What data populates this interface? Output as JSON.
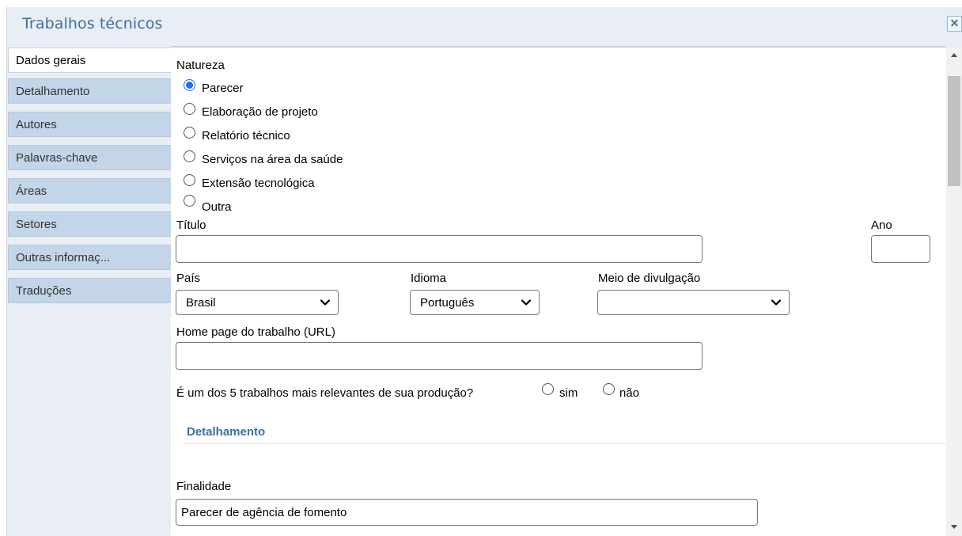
{
  "window": {
    "title": "Trabalhos técnicos",
    "close_icon": "close-icon"
  },
  "sidebar": {
    "items": [
      {
        "label": "Dados gerais",
        "active": true
      },
      {
        "label": "Detalhamento",
        "active": false
      },
      {
        "label": "Autores",
        "active": false
      },
      {
        "label": "Palavras-chave",
        "active": false
      },
      {
        "label": "Áreas",
        "active": false
      },
      {
        "label": "Setores",
        "active": false
      },
      {
        "label": "Outras informaç...",
        "active": false
      },
      {
        "label": "Traduções",
        "active": false
      }
    ]
  },
  "form": {
    "natureza": {
      "label": "Natureza",
      "options": [
        {
          "label": "Parecer",
          "checked": true
        },
        {
          "label": "Elaboração de projeto",
          "checked": false
        },
        {
          "label": "Relatório técnico",
          "checked": false
        },
        {
          "label": "Serviços na área da saúde",
          "checked": false
        },
        {
          "label": "Extensão tecnológica",
          "checked": false
        },
        {
          "label": "Outra",
          "checked": false
        }
      ]
    },
    "titulo": {
      "label": "Título",
      "value": ""
    },
    "ano": {
      "label": "Ano",
      "value": ""
    },
    "pais": {
      "label": "País",
      "value": "Brasil"
    },
    "idioma": {
      "label": "Idioma",
      "value": "Português"
    },
    "meio": {
      "label": "Meio de divulgação",
      "value": ""
    },
    "homepage": {
      "label": "Home page do trabalho (URL)",
      "value": ""
    },
    "relevante": {
      "question": "É um dos 5 trabalhos mais relevantes de sua produção?",
      "yes": "sim",
      "no": "não"
    },
    "detalhamento_section": "Detalhamento",
    "finalidade": {
      "label": "Finalidade",
      "value": "Parecer de agência de fomento"
    }
  },
  "colors": {
    "accent": "#3e6f9e",
    "tab_bg": "#c3d5e8",
    "frame_bg": "#e9eef5",
    "radio_checked": "#1a73e8"
  }
}
